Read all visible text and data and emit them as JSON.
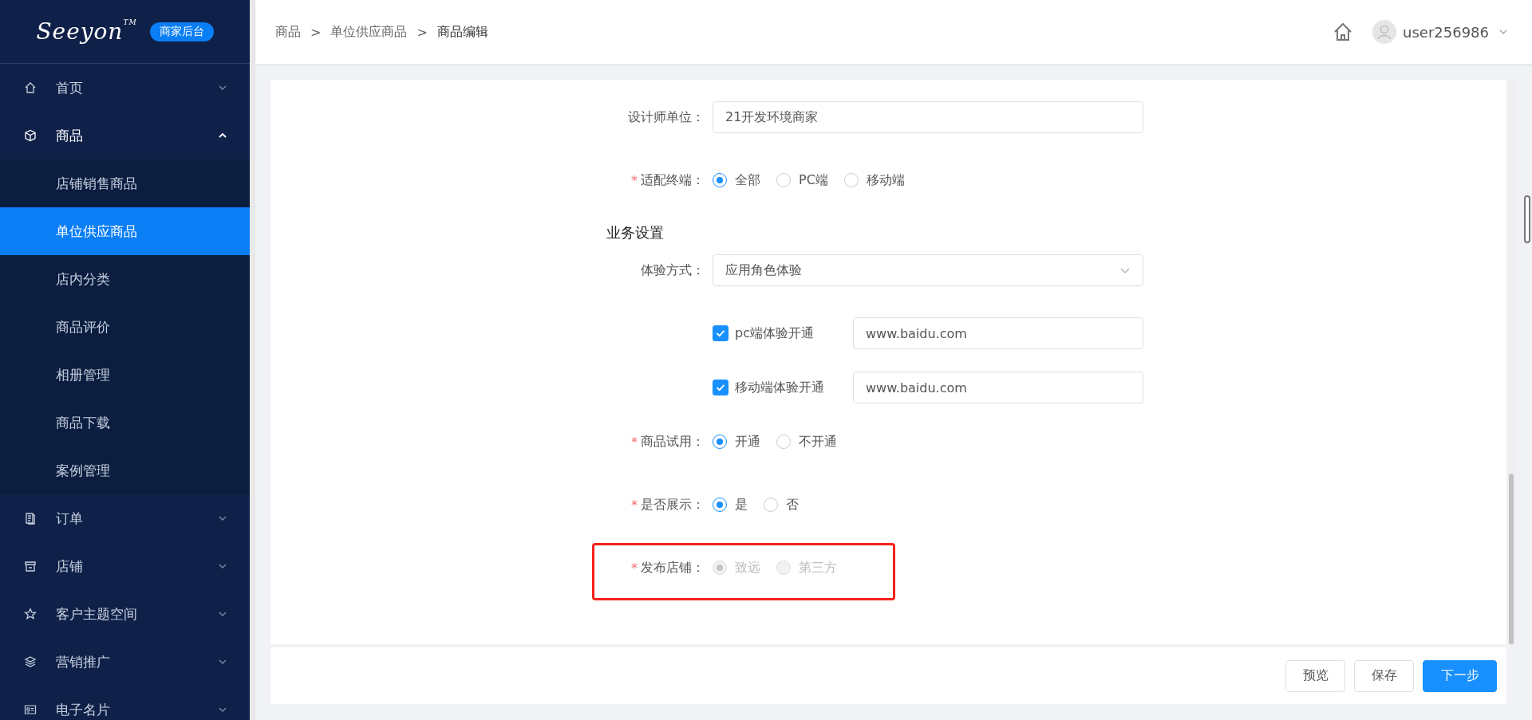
{
  "logo": {
    "text": "Seeyon",
    "trademark": "TM",
    "badge": "商家后台"
  },
  "sidebar": {
    "items": [
      {
        "label": "首页",
        "expanded": false
      },
      {
        "label": "商品",
        "expanded": true,
        "children": [
          {
            "label": "店铺销售商品",
            "selected": false
          },
          {
            "label": "单位供应商品",
            "selected": true
          },
          {
            "label": "店内分类",
            "selected": false
          },
          {
            "label": "商品评价",
            "selected": false
          },
          {
            "label": "相册管理",
            "selected": false
          },
          {
            "label": "商品下载",
            "selected": false
          },
          {
            "label": "案例管理",
            "selected": false
          }
        ]
      },
      {
        "label": "订单",
        "expanded": false
      },
      {
        "label": "店铺",
        "expanded": false
      },
      {
        "label": "客户主题空间",
        "expanded": false
      },
      {
        "label": "营销推广",
        "expanded": false
      },
      {
        "label": "电子名片",
        "expanded": false
      }
    ]
  },
  "header": {
    "breadcrumb": [
      "商品",
      "单位供应商品",
      "商品编辑"
    ],
    "separator": ">",
    "username": "user256986"
  },
  "form": {
    "required_mark": "*",
    "rows": [
      {
        "kind": "input",
        "label": "设计师单位：",
        "required": false,
        "value": "21开发环境商家"
      },
      {
        "kind": "radio",
        "label": "适配终端：",
        "required": true,
        "disabled": false,
        "highlighted": false,
        "options": [
          {
            "label": "全部",
            "selected": true
          },
          {
            "label": "PC端",
            "selected": false
          },
          {
            "label": "移动端",
            "selected": false
          }
        ]
      },
      {
        "kind": "section",
        "label": "业务设置"
      },
      {
        "kind": "select",
        "label": "体验方式：",
        "required": false,
        "value": "应用角色体验"
      },
      {
        "kind": "check-url",
        "label": "pc端体验开通",
        "checked": true,
        "value": "www.baidu.com"
      },
      {
        "kind": "check-url",
        "label": "移动端体验开通",
        "checked": true,
        "value": "www.baidu.com"
      },
      {
        "kind": "radio",
        "label": "商品试用：",
        "required": true,
        "disabled": false,
        "highlighted": false,
        "options": [
          {
            "label": "开通",
            "selected": true
          },
          {
            "label": "不开通",
            "selected": false
          }
        ]
      },
      {
        "kind": "radio",
        "label": "是否展示：",
        "required": true,
        "disabled": false,
        "highlighted": false,
        "options": [
          {
            "label": "是",
            "selected": true
          },
          {
            "label": "否",
            "selected": false
          }
        ]
      },
      {
        "kind": "radio",
        "label": "发布店铺：",
        "required": true,
        "disabled": true,
        "highlighted": true,
        "options": [
          {
            "label": "致远",
            "selected": true
          },
          {
            "label": "第三方",
            "selected": false
          }
        ]
      }
    ]
  },
  "footer": {
    "buttons": [
      {
        "label": "预览",
        "primary": false
      },
      {
        "label": "保存",
        "primary": false
      },
      {
        "label": "下一步",
        "primary": true
      }
    ]
  }
}
